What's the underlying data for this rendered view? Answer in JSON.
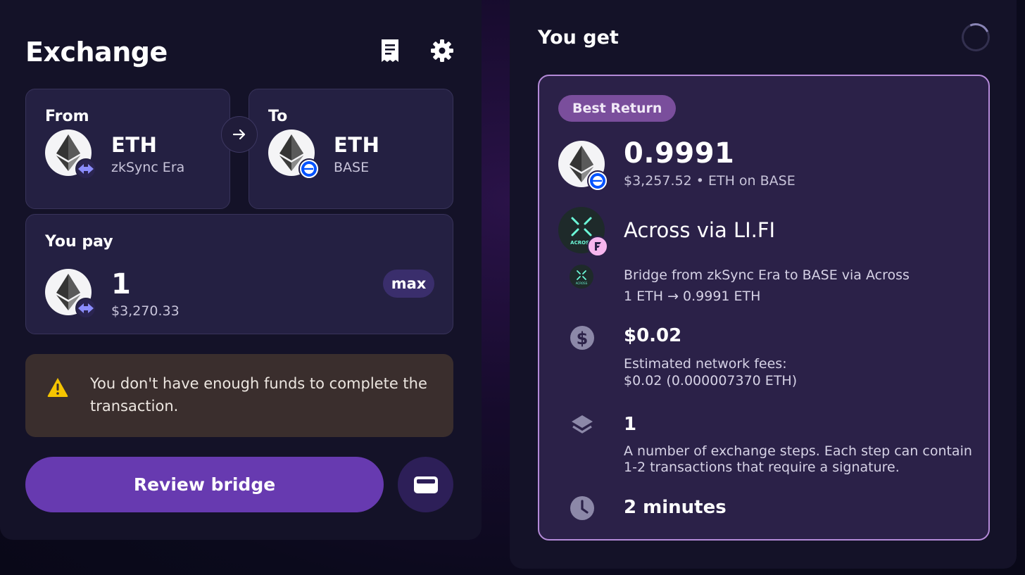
{
  "exchange": {
    "title": "Exchange",
    "icons": {
      "history": "receipt-icon",
      "settings": "gear-icon"
    },
    "from": {
      "label": "From",
      "symbol": "ETH",
      "chain": "zkSync Era"
    },
    "to": {
      "label": "To",
      "symbol": "ETH",
      "chain": "BASE"
    },
    "pay": {
      "label": "You pay",
      "amount": "1",
      "usd": "$3,270.33",
      "max_label": "max"
    },
    "warning": {
      "text": "You don't have enough funds to complete the transaction."
    },
    "review_label": "Review bridge"
  },
  "result": {
    "title": "You get",
    "badge": "Best Return",
    "amount": "0.9991",
    "sub": "$3,257.52 • ETH on BASE",
    "provider": "Across via LI.FI",
    "step_title": "Bridge from zkSync Era to BASE via Across",
    "step_amount": "1 ETH → 0.9991 ETH",
    "fee_value": "$0.02",
    "fee_desc_1": "Estimated network fees:",
    "fee_desc_2": "$0.02 (0.000007370 ETH)",
    "steps_value": "1",
    "steps_desc": "A number of exchange steps. Each step can contain 1-2 transactions that require a signature.",
    "time_value": "2 minutes",
    "across_text": "ACROSS"
  },
  "colors": {
    "accent": "#673ab0",
    "highlight_border": "#b48ad8",
    "warning": "#f5c400",
    "across": "#6cf9d8"
  }
}
